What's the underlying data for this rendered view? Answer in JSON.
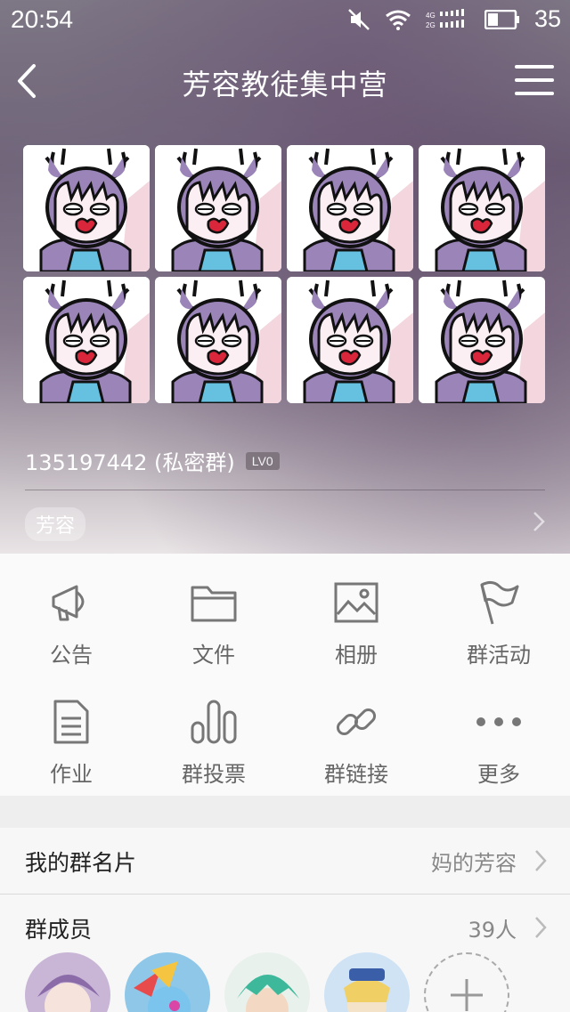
{
  "status": {
    "time": "20:54",
    "network": "4G 2G",
    "battery": "35"
  },
  "nav": {
    "title": "芳容教徒集中营"
  },
  "group": {
    "id_text": "135197442 (私密群)",
    "level": "LV0",
    "tag": "芳容",
    "avatar_count": 8
  },
  "functions": [
    {
      "label": "公告",
      "icon": "megaphone-icon"
    },
    {
      "label": "文件",
      "icon": "folder-icon"
    },
    {
      "label": "相册",
      "icon": "photo-icon"
    },
    {
      "label": "群活动",
      "icon": "flag-icon"
    },
    {
      "label": "作业",
      "icon": "document-icon"
    },
    {
      "label": "群投票",
      "icon": "bar-chart-icon"
    },
    {
      "label": "群链接",
      "icon": "link-icon"
    },
    {
      "label": "更多",
      "icon": "more-icon"
    }
  ],
  "card": {
    "label": "我的群名片",
    "value": "妈的芳容"
  },
  "members": {
    "label": "群成员",
    "value": "39人"
  },
  "colors": {
    "hero_top": "#6b5e74",
    "panel": "#fafafb",
    "text_muted": "#666666"
  }
}
